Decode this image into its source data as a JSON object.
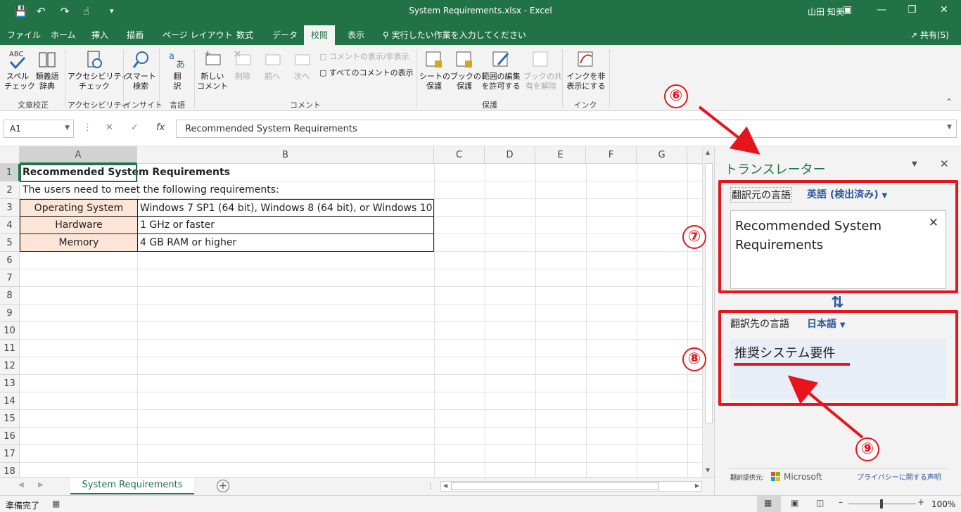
{
  "window": {
    "title": "System Requirements.xlsx - Excel",
    "user": "山田 知美"
  },
  "tabs": [
    "ファイル",
    "ホーム",
    "挿入",
    "描画",
    "ページ レイアウト",
    "数式",
    "データ",
    "校閲",
    "表示"
  ],
  "active_tab": "校閲",
  "tell_me": "実行したい作業を入力してください",
  "share": "共有(S)",
  "ribbon": {
    "spell_check": "スペル\nチェック",
    "thesaurus": "類義語\n辞典",
    "accessibility": "アクセシビリティ\nチェック",
    "smart_lookup": "スマート\n検索",
    "translate": "翻\n訳",
    "new_comment": "新しい\nコメント",
    "delete": "削除",
    "previous": "前へ",
    "next": "次へ",
    "show_hide_comment": "コメントの表示/非表示",
    "show_all_comments": "すべてのコメントの表示",
    "protect_sheet": "シートの\n保護",
    "protect_workbook": "ブックの\n保護",
    "allow_edit_ranges": "範囲の編集\nを許可する",
    "unshare_workbook": "ブックの共\n有を解除",
    "hide_ink": "インクを非\n表示にする",
    "groups": {
      "proofing": "文章校正",
      "accessibility": "アクセシビリティ",
      "insights": "インサイト",
      "language": "言語",
      "comments": "コメント",
      "protect": "保護",
      "ink": "インク"
    }
  },
  "formula_bar": {
    "name_box": "A1",
    "formula": "Recommended System Requirements"
  },
  "columns": [
    "A",
    "B",
    "C",
    "D",
    "E",
    "F",
    "G"
  ],
  "rows": [
    "1",
    "2",
    "3",
    "4",
    "5",
    "6",
    "7",
    "8",
    "9",
    "10",
    "11",
    "12",
    "13",
    "14",
    "15",
    "16",
    "17",
    "18"
  ],
  "cells": {
    "a1": "Recommended System Requirements",
    "a2": "The users need to meet the following requirements:",
    "a3": "Operating System",
    "b3": "Windows 7 SP1 (64 bit), Windows 8 (64 bit), or Windows 10",
    "a4": "Hardware",
    "b4": "1 GHz or faster",
    "a5": "Memory",
    "b5": "4 GB RAM or higher"
  },
  "sheet_tab": "System Requirements",
  "status": {
    "ready": "準備完了",
    "zoom": "100%"
  },
  "translator": {
    "title": "トランスレーター",
    "source_label": "翻訳元の言語",
    "source_lang": "英語 (検出済み)",
    "source_text": "Recommended System Requirements",
    "target_label": "翻訳先の言語",
    "target_lang": "日本語",
    "target_text": "推奨システム要件",
    "provider_label": "翻訳提供元:",
    "provider": "Microsoft",
    "privacy": "プライバシーに関する声明"
  },
  "callouts": [
    "⑥",
    "⑦",
    "⑧",
    "⑨"
  ],
  "colors": {
    "excel_green": "#217346",
    "annotation_red": "#e8141c",
    "label_fill": "#fce4d6",
    "lang_blue": "#2b579a"
  }
}
